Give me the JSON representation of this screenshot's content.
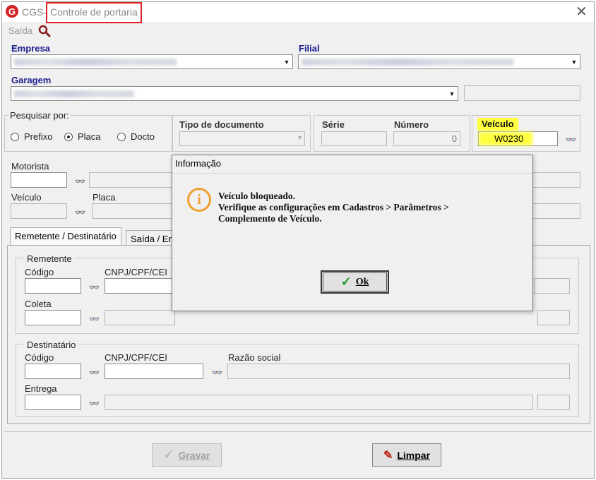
{
  "window": {
    "app_name": "CGS",
    "title_separator": "-",
    "title": "Controle de portaria",
    "close_icon": "close-icon",
    "logo_letter": "G"
  },
  "menu": {
    "saida": "Saída",
    "search_icon": "search-icon"
  },
  "fields": {
    "empresa_label": "Empresa",
    "filial_label": "Filial",
    "garagem_label": "Garagem"
  },
  "search": {
    "legend": "Pesquisar por:",
    "options": [
      "Prefixo",
      "Placa",
      "Docto"
    ],
    "selected": "Placa"
  },
  "doc": {
    "tipo_label": "Tipo de documento",
    "serie_label": "Série",
    "numero_label": "Número",
    "numero_value": "0",
    "veiculo_label": "Veículo",
    "veiculo_value": "W0230"
  },
  "motorista": {
    "motorista_label": "Motorista",
    "veiculo_label": "Veículo",
    "placa_label": "Placa"
  },
  "tabs": [
    "Remetente / Destinatário",
    "Saída / En"
  ],
  "remetente": {
    "legend": "Remetente",
    "codigo_label": "Código",
    "cnpj_label": "CNPJ/CPF/CEI",
    "coleta_label": "Coleta"
  },
  "destinatario": {
    "legend": "Destinatário",
    "codigo_label": "Código",
    "cnpj_label": "CNPJ/CPF/CEI",
    "razao_label": "Razão social",
    "entrega_label": "Entrega"
  },
  "buttons": {
    "gravar": "Gravar",
    "limpar": "Limpar"
  },
  "dialog": {
    "title": "Informação",
    "line1": "Veículo bloqueado.",
    "line2": "Verifique as configurações em Cadastros > Parâmetros >",
    "line3": "Complemento de Veículo.",
    "ok": "Ok"
  },
  "colors": {
    "highlight_red": "#e02020",
    "highlight_yellow": "#ffff40",
    "label_blue": "#1a1a8c",
    "info_orange": "#f0a030",
    "ok_check_green": "#2a9a2a"
  }
}
